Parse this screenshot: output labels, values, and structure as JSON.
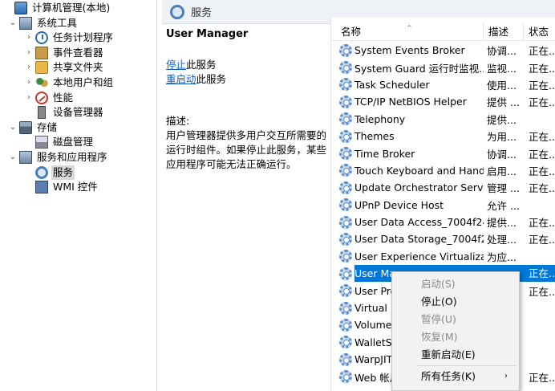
{
  "tree": {
    "items": [
      {
        "label": "计算机管理(本地)",
        "icon": "computer-icon",
        "level": 0,
        "expander": ""
      },
      {
        "label": "系统工具",
        "icon": "toolbox-icon",
        "level": 1,
        "expander": "⌄"
      },
      {
        "label": "任务计划程序",
        "icon": "clock-icon",
        "level": 2,
        "expander": "›"
      },
      {
        "label": "事件查看器",
        "icon": "event-log-icon",
        "level": 2,
        "expander": "›"
      },
      {
        "label": "共享文件夹",
        "icon": "folder-icon",
        "level": 2,
        "expander": "›"
      },
      {
        "label": "本地用户和组",
        "icon": "users-icon",
        "level": 2,
        "expander": "›"
      },
      {
        "label": "性能",
        "icon": "performance-icon",
        "level": 2,
        "expander": "›"
      },
      {
        "label": "设备管理器",
        "icon": "device-icon",
        "level": 2,
        "expander": ""
      },
      {
        "label": "存储",
        "icon": "storage-icon",
        "level": 1,
        "expander": "⌄"
      },
      {
        "label": "磁盘管理",
        "icon": "disk-icon",
        "level": 2,
        "expander": ""
      },
      {
        "label": "服务和应用程序",
        "icon": "apps-icon",
        "level": 1,
        "expander": "⌄"
      },
      {
        "label": "服务",
        "icon": "services-icon",
        "level": 2,
        "expander": "",
        "selected": true
      },
      {
        "label": "WMI 控件",
        "icon": "wmi-icon",
        "level": 2,
        "expander": ""
      }
    ]
  },
  "header": {
    "title": "服务"
  },
  "desc": {
    "service_name": "User Manager",
    "stop_link": "停止",
    "stop_suffix": "此服务",
    "restart_link": "重启动",
    "restart_suffix": "此服务",
    "desc_label": "描述:",
    "desc_text": "用户管理器提供多用户交互所需要的运行时组件。如果停止此服务，某些应用程序可能无法正确运行。"
  },
  "list": {
    "columns": {
      "name": "名称",
      "desc": "描述",
      "status": "状态"
    },
    "rows": [
      {
        "name": "System Events Broker",
        "desc": "协调...",
        "status": "正在..."
      },
      {
        "name": "System Guard 运行时监视...",
        "desc": "监视...",
        "status": "正在..."
      },
      {
        "name": "Task Scheduler",
        "desc": "使用...",
        "status": "正在..."
      },
      {
        "name": "TCP/IP NetBIOS Helper",
        "desc": "提供 ...",
        "status": "正在..."
      },
      {
        "name": "Telephony",
        "desc": "提供...",
        "status": ""
      },
      {
        "name": "Themes",
        "desc": "为用...",
        "status": "正在..."
      },
      {
        "name": "Time Broker",
        "desc": "协调...",
        "status": "正在..."
      },
      {
        "name": "Touch Keyboard and Hand...",
        "desc": "启用...",
        "status": "正在..."
      },
      {
        "name": "Update Orchestrator Service",
        "desc": "管理 ...",
        "status": "正在..."
      },
      {
        "name": "UPnP Device Host",
        "desc": "允许 ...",
        "status": ""
      },
      {
        "name": "User Data Access_7004f24",
        "desc": "提供...",
        "status": "正在..."
      },
      {
        "name": "User Data Storage_7004f24",
        "desc": "处理...",
        "status": "正在..."
      },
      {
        "name": "User Experience Virtualizat...",
        "desc": "为应...",
        "status": ""
      },
      {
        "name": "User Ma",
        "desc": "",
        "status": "正在...",
        "selected": true
      },
      {
        "name": "User Pro",
        "desc": "",
        "status": "正在..."
      },
      {
        "name": "Virtual D",
        "desc": "",
        "status": ""
      },
      {
        "name": "Volume",
        "desc": "",
        "status": ""
      },
      {
        "name": "WalletSe",
        "desc": "",
        "status": ""
      },
      {
        "name": "WarpJITS",
        "desc": "",
        "status": ""
      },
      {
        "name": "Web 帐户",
        "desc": "",
        "status": "正在..."
      }
    ]
  },
  "context_menu": {
    "items": [
      {
        "label": "启动(S)",
        "disabled": true
      },
      {
        "label": "停止(O)",
        "disabled": false
      },
      {
        "label": "暂停(U)",
        "disabled": true
      },
      {
        "label": "恢复(M)",
        "disabled": true
      },
      {
        "label": "重新启动(E)",
        "disabled": false
      },
      {
        "separator": true
      },
      {
        "label": "所有任务(K)",
        "disabled": false,
        "submenu": "›"
      }
    ]
  }
}
